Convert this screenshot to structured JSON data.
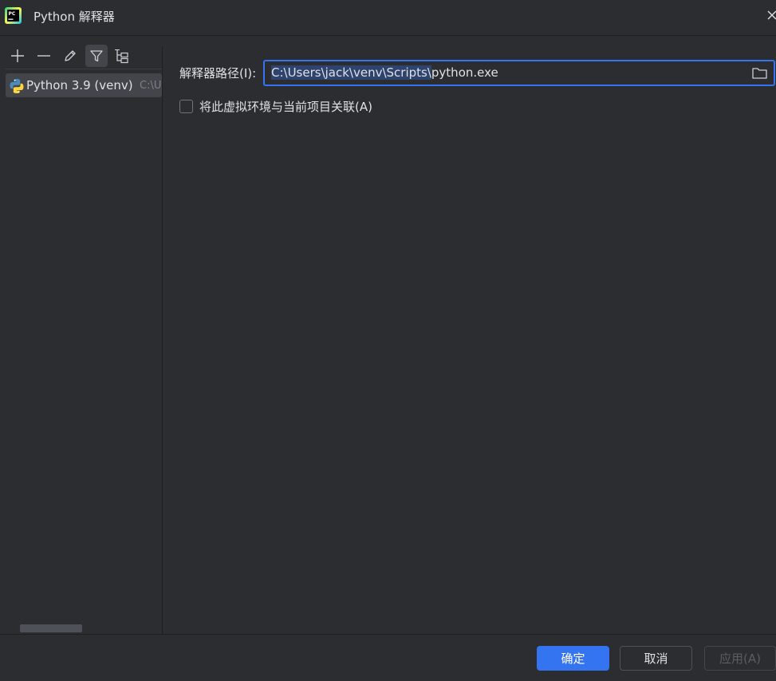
{
  "window": {
    "title": "Python 解释器",
    "app_icon": "pycharm-icon",
    "close_icon": "close-icon"
  },
  "toolbar": {
    "buttons": [
      "add-icon",
      "remove-icon",
      "edit-icon",
      "filter-icon",
      "tree-icon"
    ],
    "active": "filter-icon"
  },
  "interpreters": [
    {
      "name": "Python 3.9 (venv)",
      "path": "C:\\U",
      "icon": "python-icon",
      "selected": true
    }
  ],
  "form": {
    "path_label": "解释器路径(I):",
    "path_selected": "C:\\Users\\jack\\venv\\Scripts\\",
    "path_rest": "python.exe",
    "browse_icon": "folder-icon",
    "associate_label": "将此虚拟环境与当前项目关联(A)",
    "associate_checked": false
  },
  "buttons": {
    "ok": "确定",
    "cancel": "取消",
    "apply": "应用(A)"
  },
  "colors": {
    "background": "#2b2d30",
    "accent": "#3574f0",
    "selection": "#43454a",
    "text_selection": "#2e436e"
  }
}
